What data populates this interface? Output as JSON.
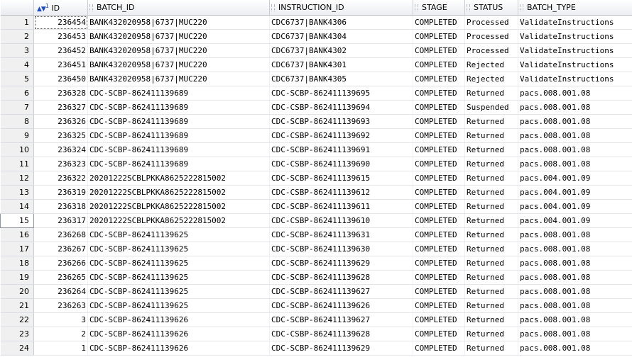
{
  "columns": [
    "ID",
    "BATCH_ID",
    "INSTRUCTION_ID",
    "STAGE",
    "STATUS",
    "BATCH_TYPE"
  ],
  "sort_indicator": {
    "priority": "1"
  },
  "rows": [
    {
      "n": "1",
      "id": "236454",
      "batch_id": "BANK432020958|6737|MUC220",
      "instruction_id": "CDC6737|BANK4306",
      "stage": "COMPLETED",
      "status": "Processed",
      "batch_type": "ValidateInstructions"
    },
    {
      "n": "2",
      "id": "236453",
      "batch_id": "BANK432020958|6737|MUC220",
      "instruction_id": "CDC6737|BANK4304",
      "stage": "COMPLETED",
      "status": "Processed",
      "batch_type": "ValidateInstructions"
    },
    {
      "n": "3",
      "id": "236452",
      "batch_id": "BANK432020958|6737|MUC220",
      "instruction_id": "CDC6737|BANK4302",
      "stage": "COMPLETED",
      "status": "Processed",
      "batch_type": "ValidateInstructions"
    },
    {
      "n": "4",
      "id": "236451",
      "batch_id": "BANK432020958|6737|MUC220",
      "instruction_id": "CDC6737|BANK4301",
      "stage": "COMPLETED",
      "status": "Rejected",
      "batch_type": "ValidateInstructions"
    },
    {
      "n": "5",
      "id": "236450",
      "batch_id": "BANK432020958|6737|MUC220",
      "instruction_id": "CDC6737|BANK4305",
      "stage": "COMPLETED",
      "status": "Rejected",
      "batch_type": "ValidateInstructions"
    },
    {
      "n": "6",
      "id": "236328",
      "batch_id": "CDC-SCBP-862411139689",
      "instruction_id": "CDC-SCBP-862411139695",
      "stage": "COMPLETED",
      "status": "Returned",
      "batch_type": "pacs.008.001.08"
    },
    {
      "n": "7",
      "id": "236327",
      "batch_id": "CDC-SCBP-862411139689",
      "instruction_id": "CDC-CSBP-862411139694",
      "stage": "COMPLETED",
      "status": "Suspended",
      "batch_type": "pacs.008.001.08"
    },
    {
      "n": "8",
      "id": "236326",
      "batch_id": "CDC-SCBP-862411139689",
      "instruction_id": "CDC-SCBP-862411139693",
      "stage": "COMPLETED",
      "status": "Returned",
      "batch_type": "pacs.008.001.08"
    },
    {
      "n": "9",
      "id": "236325",
      "batch_id": "CDC-SCBP-862411139689",
      "instruction_id": "CDC-CSBP-862411139692",
      "stage": "COMPLETED",
      "status": "Returned",
      "batch_type": "pacs.008.001.08"
    },
    {
      "n": "10",
      "id": "236324",
      "batch_id": "CDC-SCBP-862411139689",
      "instruction_id": "CDC-SCBP-862411139691",
      "stage": "COMPLETED",
      "status": "Returned",
      "batch_type": "pacs.008.001.08"
    },
    {
      "n": "11",
      "id": "236323",
      "batch_id": "CDC-SCBP-862411139689",
      "instruction_id": "CDC-CSBP-862411139690",
      "stage": "COMPLETED",
      "status": "Returned",
      "batch_type": "pacs.008.001.08"
    },
    {
      "n": "12",
      "id": "236322",
      "batch_id": "20201222SCBLPKKA8625222815002",
      "instruction_id": "CDC-SCBP-862411139615",
      "stage": "COMPLETED",
      "status": "Returned",
      "batch_type": "pacs.004.001.09"
    },
    {
      "n": "13",
      "id": "236319",
      "batch_id": "20201222SCBLPKKA8625222815002",
      "instruction_id": "CDC-CSBP-862411139612",
      "stage": "COMPLETED",
      "status": "Returned",
      "batch_type": "pacs.004.001.09"
    },
    {
      "n": "14",
      "id": "236318",
      "batch_id": "20201222SCBLPKKA8625222815002",
      "instruction_id": "CDC-SCBP-862411139611",
      "stage": "COMPLETED",
      "status": "Returned",
      "batch_type": "pacs.004.001.09"
    },
    {
      "n": "15",
      "id": "236317",
      "batch_id": "20201222SCBLPKKA8625222815002",
      "instruction_id": "CDC-CSBP-862411139610",
      "stage": "COMPLETED",
      "status": "Returned",
      "batch_type": "pacs.004.001.09"
    },
    {
      "n": "16",
      "id": "236268",
      "batch_id": "CDC-SCBP-862411139625",
      "instruction_id": "CDC-SCBP-862411139631",
      "stage": "COMPLETED",
      "status": "Returned",
      "batch_type": "pacs.008.001.08"
    },
    {
      "n": "17",
      "id": "236267",
      "batch_id": "CDC-SCBP-862411139625",
      "instruction_id": "CDC-SCBP-862411139630",
      "stage": "COMPLETED",
      "status": "Returned",
      "batch_type": "pacs.008.001.08"
    },
    {
      "n": "18",
      "id": "236266",
      "batch_id": "CDC-SCBP-862411139625",
      "instruction_id": "CDC-SCBP-862411139629",
      "stage": "COMPLETED",
      "status": "Returned",
      "batch_type": "pacs.008.001.08"
    },
    {
      "n": "19",
      "id": "236265",
      "batch_id": "CDC-SCBP-862411139625",
      "instruction_id": "CDC-SCBP-862411139628",
      "stage": "COMPLETED",
      "status": "Returned",
      "batch_type": "pacs.008.001.08"
    },
    {
      "n": "20",
      "id": "236264",
      "batch_id": "CDC-SCBP-862411139625",
      "instruction_id": "CDC-SCBP-862411139627",
      "stage": "COMPLETED",
      "status": "Returned",
      "batch_type": "pacs.008.001.08"
    },
    {
      "n": "21",
      "id": "236263",
      "batch_id": "CDC-SCBP-862411139625",
      "instruction_id": "CDC-SCBP-862411139626",
      "stage": "COMPLETED",
      "status": "Returned",
      "batch_type": "pacs.008.001.08"
    },
    {
      "n": "22",
      "id": "3",
      "batch_id": "CDC-SCBP-862411139626",
      "instruction_id": "CDC-SCBP-862411139627",
      "stage": "COMPLETED",
      "status": "Returned",
      "batch_type": "pacs.008.001.08"
    },
    {
      "n": "23",
      "id": "2",
      "batch_id": "CDC-SCBP-862411139626",
      "instruction_id": "CDC-CSBP-862411139628",
      "stage": "COMPLETED",
      "status": "Returned",
      "batch_type": "pacs.008.001.08"
    },
    {
      "n": "24",
      "id": "1",
      "batch_id": "CDC-SCBP-862411139626",
      "instruction_id": "CDC-SCBP-862411139629",
      "stage": "COMPLETED",
      "status": "Returned",
      "batch_type": "pacs.008.001.08"
    }
  ]
}
